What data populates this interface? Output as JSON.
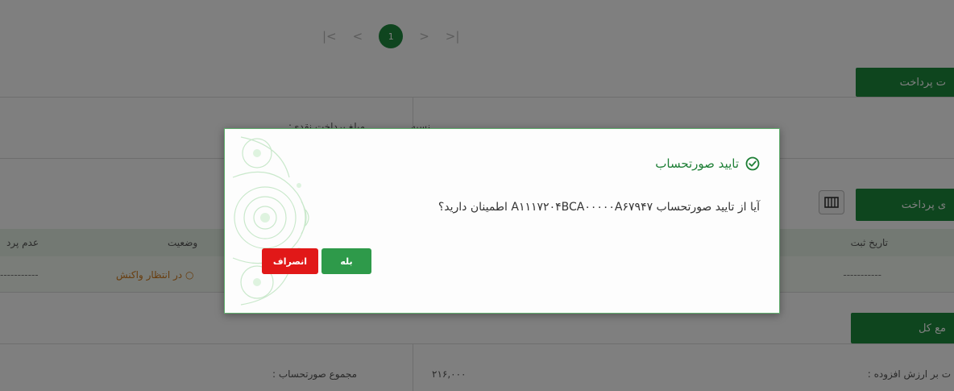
{
  "pager": {
    "first": "|<",
    "prev": "<",
    "current": "1",
    "next": ">",
    "last": ">|"
  },
  "sections": {
    "payment_info_tab": "ت پرداخت",
    "payments_tab": "ی پرداخت",
    "total_tab": "مع کل"
  },
  "payment_info": {
    "type_value": "نسیه",
    "cash_label": "مبلغ پرداخت نقدی:"
  },
  "table": {
    "headers": {
      "reg_date": "تاریخ ثبت",
      "status": "وضعیت",
      "unpaid": "عدم پرد"
    },
    "row": {
      "reg_date": "-----------",
      "status": "در انتظار واکنش",
      "unpaid": "-----------"
    }
  },
  "totals": {
    "vat_label": "ت بر ارزش افزوده :",
    "invoice_total_label": "مجموع صورتحساب :",
    "invoice_total_value": "۲۱۶,۰۰۰"
  },
  "modal": {
    "title": "تایید صورتحساب",
    "message": "آیا از تایید صورتحساب A۱۱۱۷۲۰۴BCA۰۰۰۰۰A۶۷۹۴۷ اطمینان دارید؟",
    "confirm_label": "بله",
    "cancel_label": "انصراف"
  },
  "icons": {
    "title_icon": "check-circle-icon",
    "columns_icon": "columns-icon"
  },
  "colors": {
    "primary": "#1f8a3e",
    "danger": "#e11818",
    "pending": "#d07b1d"
  }
}
